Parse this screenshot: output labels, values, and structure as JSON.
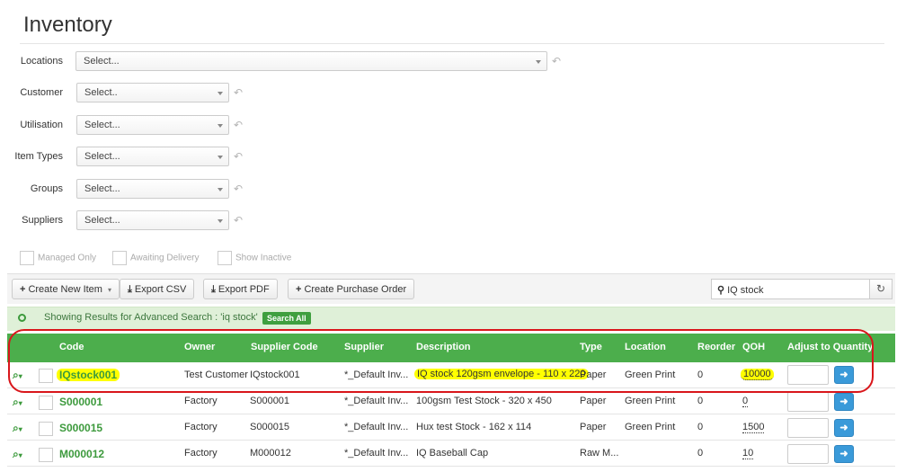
{
  "page": {
    "title": "Inventory"
  },
  "filters": [
    {
      "label": "Locations",
      "value": "Select..."
    },
    {
      "label": "Customer",
      "value": "Select.."
    },
    {
      "label": "Utilisation",
      "value": "Select..."
    },
    {
      "label": "Item Types",
      "value": "Select..."
    },
    {
      "label": "Groups",
      "value": "Select..."
    },
    {
      "label": "Suppliers",
      "value": "Select..."
    }
  ],
  "checkboxes": [
    {
      "label": "Managed Only"
    },
    {
      "label": "Awaiting Delivery"
    },
    {
      "label": "Show Inactive"
    }
  ],
  "toolbar": {
    "create_new_item": "Create New Item",
    "export_csv": "Export CSV",
    "export_pdf": "Export PDF",
    "create_purchase_order": "Create Purchase Order",
    "search_value": "IQ stock"
  },
  "results": {
    "text": "Showing Results for Advanced Search : 'iq stock'",
    "search_all": "Search All"
  },
  "columns": [
    "Code",
    "Owner",
    "Supplier Code",
    "Supplier",
    "Description",
    "Type",
    "Location",
    "Reorder",
    "QOH",
    "Adjust to Quantity"
  ],
  "rows": [
    {
      "code": "IQstock001",
      "owner": "Test Customer",
      "supplier_code": "IQstock001",
      "supplier": "*_Default Inv...",
      "description": "IQ stock 120gsm envelope - 110 x 220",
      "type": "Paper",
      "location": "Green Print",
      "reorder": "0",
      "qoh": "10000",
      "highlighted": true
    },
    {
      "code": "S000001",
      "owner": "Factory",
      "supplier_code": "S000001",
      "supplier": "*_Default Inv...",
      "description": "100gsm Test Stock - 320 x 450",
      "type": "Paper",
      "location": "Green Print",
      "reorder": "0",
      "qoh": "0",
      "highlighted": false
    },
    {
      "code": "S000015",
      "owner": "Factory",
      "supplier_code": "S000015",
      "supplier": "*_Default Inv...",
      "description": "Hux test Stock - 162 x 114",
      "type": "Paper",
      "location": "Green Print",
      "reorder": "0",
      "qoh": "1500",
      "highlighted": false
    },
    {
      "code": "M000012",
      "owner": "Factory",
      "supplier_code": "M000012",
      "supplier": "*_Default Inv...",
      "description": "IQ Baseball Cap",
      "type": "Raw M...",
      "location": "",
      "reorder": "0",
      "qoh": "10",
      "highlighted": false
    }
  ],
  "colors": {
    "header_green": "#4cae4c",
    "link_green": "#3d9a3d",
    "results_bg": "#dff0d8",
    "highlight": "#ffff00",
    "annotation_red": "#d9161b",
    "action_blue": "#3a9ad9"
  },
  "icons": {
    "reset": "undo-icon",
    "search": "search-icon",
    "clear": "clear-icon",
    "row_action": "magnify-dropdown-icon",
    "go": "arrow-right-icon"
  }
}
